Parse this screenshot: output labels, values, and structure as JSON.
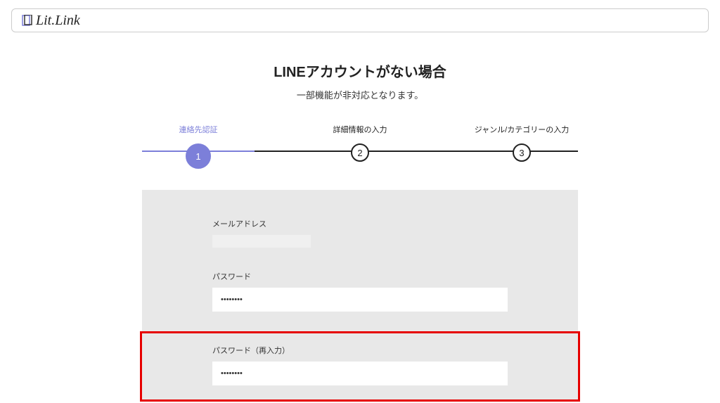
{
  "header": {
    "logo_text": "Lit.Link"
  },
  "main": {
    "title": "LINEアカウントがない場合",
    "subtitle": "一部機能が非対応となります。"
  },
  "stepper": {
    "steps": [
      {
        "label": "連絡先認証",
        "number": "1"
      },
      {
        "label": "詳細情報の入力",
        "number": "2"
      },
      {
        "label": "ジャンル/カテゴリーの入力",
        "number": "3"
      }
    ]
  },
  "form": {
    "email": {
      "label": "メールアドレス",
      "value": ""
    },
    "password": {
      "label": "パスワード",
      "value": "••••••••"
    },
    "password_confirm": {
      "label": "パスワード（再入力）",
      "value": "••••••••"
    }
  }
}
